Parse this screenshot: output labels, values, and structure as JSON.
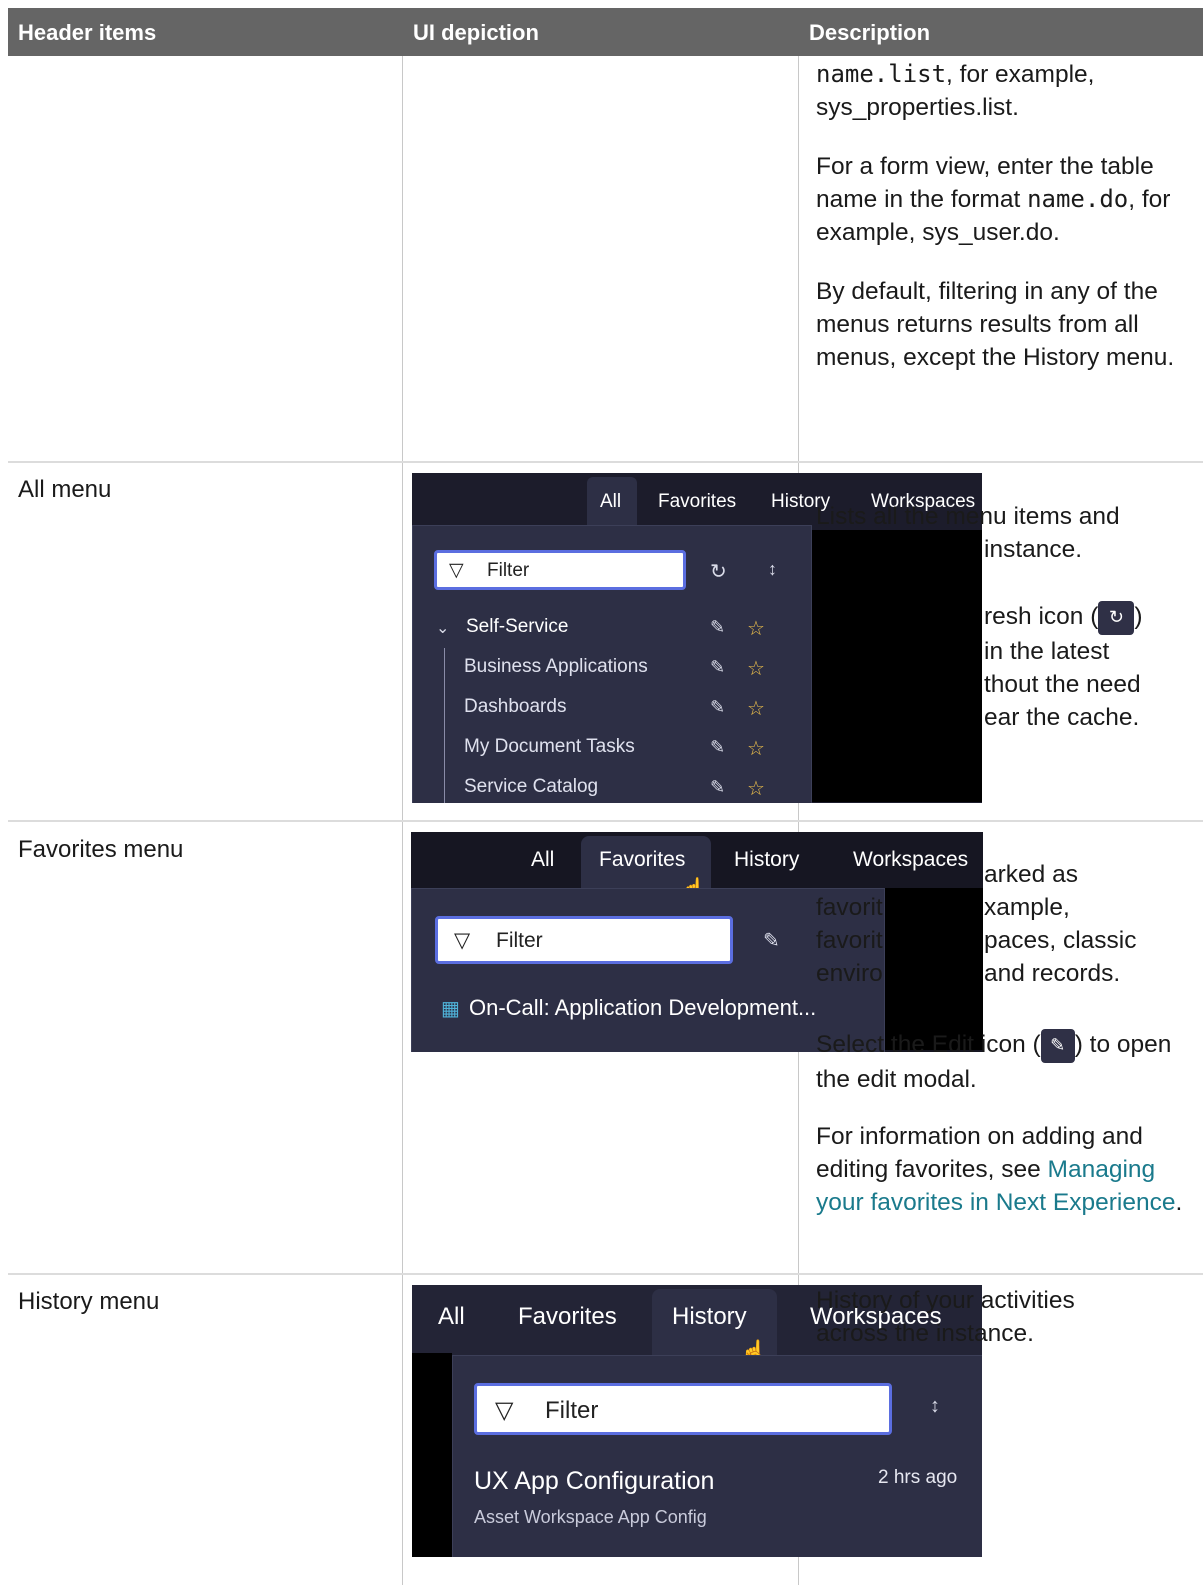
{
  "header": {
    "col1": "Header items",
    "col2": "UI depiction",
    "col3": "Description"
  },
  "row0": {
    "p1_code": "name.list",
    "p1_rest": ", for example, sys_properties.list.",
    "p2_pre": "For a form view, enter the table name in the format ",
    "p2_code": "name.do",
    "p2_post": ", for example, sys_user.do.",
    "p3": "By default, filtering in any of the menus returns results from all menus, except the History menu."
  },
  "all_menu": {
    "label": "All menu",
    "tabs": [
      "All",
      "Favorites",
      "History",
      "Workspaces"
    ],
    "filter_placeholder": "Filter",
    "items": [
      "Self-Service",
      "Business Applications",
      "Dashboards",
      "My Document Tasks",
      "Service Catalog"
    ],
    "desc_line1": "Lists all the menu items and",
    "desc_line2": "instance.",
    "desc_p2_l1": "resh icon (",
    "desc_p2_l1_end": ")",
    "desc_p2_l2": "in the latest",
    "desc_p2_l3": "thout the need",
    "desc_p2_l4": "ear the cache."
  },
  "favorites_menu": {
    "label": "Favorites menu",
    "tabs": [
      "All",
      "Favorites",
      "History",
      "Workspaces"
    ],
    "filter_placeholder": "Filter",
    "item": "On-Call: Application Development...",
    "desc_l1": "arked as",
    "desc_l2a": "favorit",
    "desc_l2b": "xample,",
    "desc_l3a": "favorit",
    "desc_l3b": "paces, classic",
    "desc_l4a": "enviro",
    "desc_l4b": "and records.",
    "desc_p2_a": "Select the Edit icon (",
    "desc_p2_b": ") to open the edit modal.",
    "desc_p3": "For information on adding and editing favorites, see ",
    "desc_link": "Managing your favorites in Next Experience",
    "desc_p3_end": "."
  },
  "history_menu": {
    "label": "History menu",
    "tabs": [
      "All",
      "Favorites",
      "History",
      "Workspaces"
    ],
    "filter_placeholder": "Filter",
    "item_title": "UX App Configuration",
    "item_sub": "Asset Workspace App Config",
    "item_time": "2 hrs ago",
    "desc_l1a": "History of your",
    "desc_l1b": " activities",
    "desc_l2a": "across the ins",
    "desc_l2b": "tance."
  },
  "colors": {
    "header_bg": "#656565",
    "link": "#1a7a8c",
    "ui_dark": "#1c1c2b",
    "filter_border": "#5b6ee0",
    "star": "#f0c24b"
  }
}
